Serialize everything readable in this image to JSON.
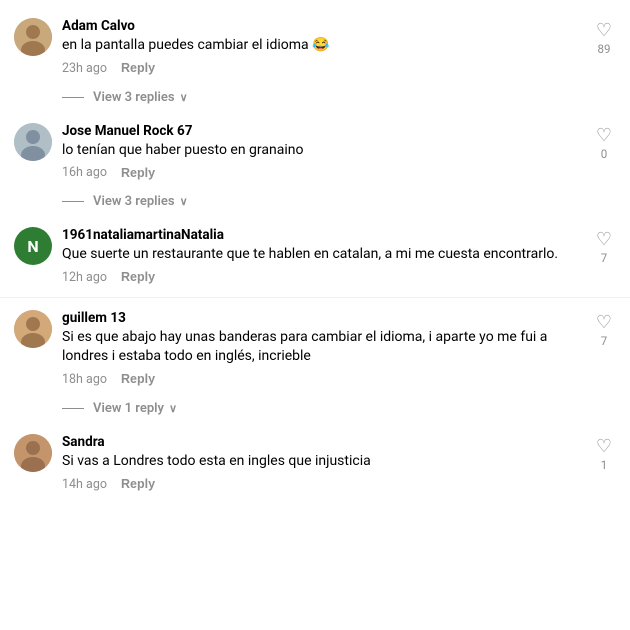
{
  "comments": [
    {
      "id": 1,
      "username": "Adam Calvo",
      "avatarType": "image",
      "avatarClass": "avatar-circle-1",
      "avatarInitial": "",
      "text": "en la pantalla puedes cambiar el idioma 😂",
      "time": "23h ago",
      "replyLabel": "Reply",
      "likeCount": "89",
      "viewReplies": "View 3 replies",
      "showViewReplies": true
    },
    {
      "id": 2,
      "username": "Jose Manuel Rock 67",
      "avatarType": "image",
      "avatarClass": "avatar-circle-2",
      "avatarInitial": "",
      "text": "lo tenían que haber puesto en granaino",
      "time": "16h ago",
      "replyLabel": "Reply",
      "likeCount": "0",
      "viewReplies": "View 3 replies",
      "showViewReplies": true
    },
    {
      "id": 3,
      "username": "1961nataliamartinaNatalia",
      "avatarType": "initial",
      "avatarClass": "avatar-green",
      "avatarInitial": "N",
      "text": "Que suerte un restaurante que te hablen en catalan, a mi me cuesta encontrarlo.",
      "time": "12h ago",
      "replyLabel": "Reply",
      "likeCount": "7",
      "viewReplies": "",
      "showViewReplies": false
    },
    {
      "id": 4,
      "username": "guillem 13",
      "avatarType": "image",
      "avatarClass": "avatar-circle-4",
      "avatarInitial": "",
      "text": "Si es que abajo hay unas banderas para cambiar el idioma, i aparte yo me fui a londres i estaba todo en inglés, incrieble",
      "time": "18h ago",
      "replyLabel": "Reply",
      "likeCount": "7",
      "viewReplies": "View 1 reply",
      "showViewReplies": true
    },
    {
      "id": 5,
      "username": "Sandra",
      "avatarType": "image",
      "avatarClass": "avatar-circle-5",
      "avatarInitial": "",
      "text": "Si vas a Londres todo esta en ingles que injusticia",
      "time": "14h ago",
      "replyLabel": "Reply",
      "likeCount": "1",
      "viewReplies": "",
      "showViewReplies": false
    }
  ],
  "ui": {
    "chevron": "∨",
    "heart": "♡"
  }
}
